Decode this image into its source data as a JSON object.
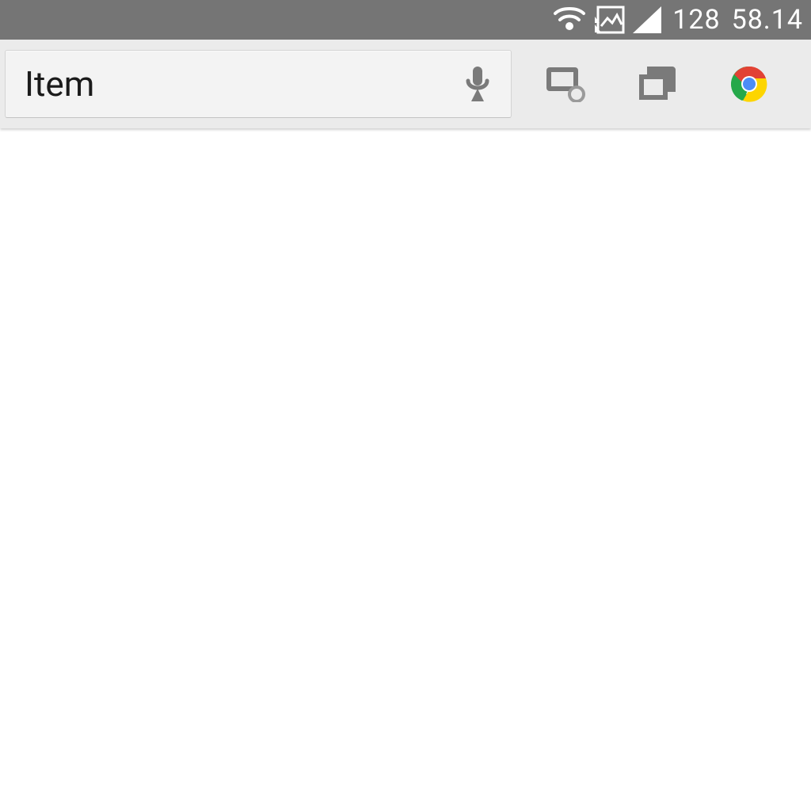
{
  "status_bar": {
    "battery_or_count": "128",
    "clock": "58.14"
  },
  "toolbar": {
    "search_value": "Item",
    "icons": {
      "mic": "mic-icon",
      "cast": "cast-icon",
      "tabs": "tabs-icon",
      "chrome": "chrome-icon"
    }
  },
  "colors": {
    "status_bg": "#757575",
    "toolbar_bg": "#ebebeb",
    "icon_gray": "#7a7a7a"
  }
}
